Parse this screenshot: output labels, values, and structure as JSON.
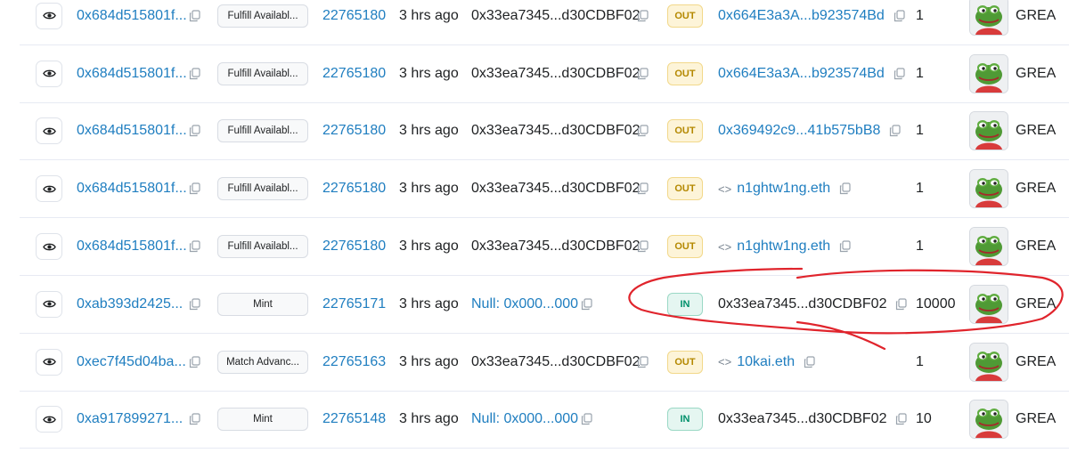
{
  "rows": [
    {
      "txn_hash": "0x684d515801f...",
      "method": "Fulfill Availabl...",
      "block": "22765180",
      "age": "3 hrs ago",
      "from": "0x33ea7345...d30CDBF02",
      "from_link": false,
      "direction": "OUT",
      "to": "0x664E3a3A...b923574Bd",
      "to_contract": false,
      "quantity": "1",
      "token": "GREA"
    },
    {
      "txn_hash": "0x684d515801f...",
      "method": "Fulfill Availabl...",
      "block": "22765180",
      "age": "3 hrs ago",
      "from": "0x33ea7345...d30CDBF02",
      "from_link": false,
      "direction": "OUT",
      "to": "0x664E3a3A...b923574Bd",
      "to_contract": false,
      "quantity": "1",
      "token": "GREA"
    },
    {
      "txn_hash": "0x684d515801f...",
      "method": "Fulfill Availabl...",
      "block": "22765180",
      "age": "3 hrs ago",
      "from": "0x33ea7345...d30CDBF02",
      "from_link": false,
      "direction": "OUT",
      "to": "0x369492c9...41b575bB8",
      "to_contract": false,
      "quantity": "1",
      "token": "GREA"
    },
    {
      "txn_hash": "0x684d515801f...",
      "method": "Fulfill Availabl...",
      "block": "22765180",
      "age": "3 hrs ago",
      "from": "0x33ea7345...d30CDBF02",
      "from_link": false,
      "direction": "OUT",
      "to": "n1ghtw1ng.eth",
      "to_contract": true,
      "quantity": "1",
      "token": "GREA"
    },
    {
      "txn_hash": "0x684d515801f...",
      "method": "Fulfill Availabl...",
      "block": "22765180",
      "age": "3 hrs ago",
      "from": "0x33ea7345...d30CDBF02",
      "from_link": false,
      "direction": "OUT",
      "to": "n1ghtw1ng.eth",
      "to_contract": true,
      "quantity": "1",
      "token": "GREA"
    },
    {
      "txn_hash": "0xab393d2425...",
      "method": "Mint",
      "block": "22765171",
      "age": "3 hrs ago",
      "from": "Null: 0x000...000",
      "from_link": true,
      "direction": "IN",
      "to": "0x33ea7345...d30CDBF02",
      "to_contract": false,
      "quantity": "10000",
      "token": "GREA"
    },
    {
      "txn_hash": "0xec7f45d04ba...",
      "method": "Match Advanc...",
      "block": "22765163",
      "age": "3 hrs ago",
      "from": "0x33ea7345...d30CDBF02",
      "from_link": false,
      "direction": "OUT",
      "to": "10kai.eth",
      "to_contract": true,
      "quantity": "1",
      "token": "GREA"
    },
    {
      "txn_hash": "0xa917899271...",
      "method": "Mint",
      "block": "22765148",
      "age": "3 hrs ago",
      "from": "Null: 0x000...000",
      "from_link": true,
      "direction": "IN",
      "to": "0x33ea7345...d30CDBF02",
      "to_contract": false,
      "quantity": "10",
      "token": "GREA"
    }
  ],
  "colors": {
    "link": "#1f7ec0",
    "out_badge": "#b48800",
    "in_badge": "#00906b",
    "annotation": "#e0242c"
  },
  "icons": {
    "view": "eye-icon",
    "copy": "copy-icon",
    "contract": "code-icon",
    "avatar": "pepe-frog-avatar"
  }
}
